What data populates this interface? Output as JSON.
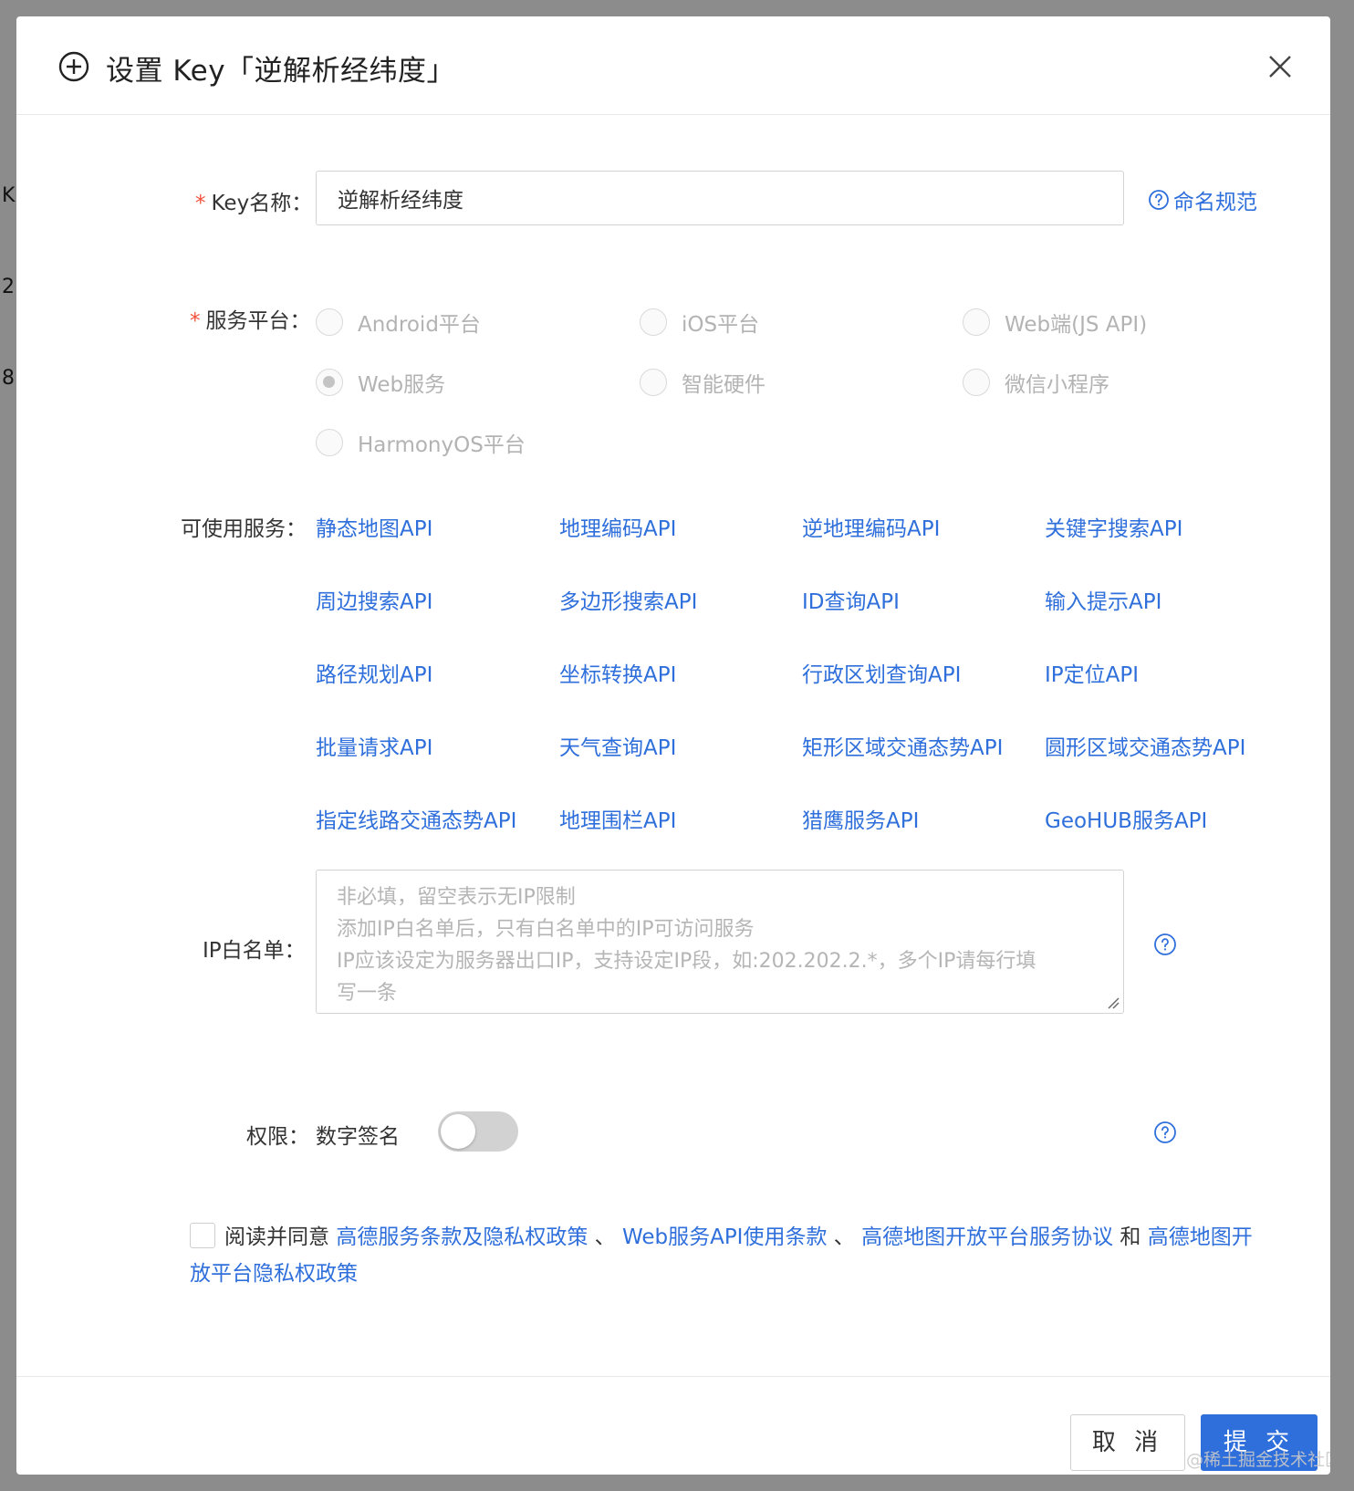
{
  "background": {
    "chars": [
      "K",
      "2",
      "8"
    ]
  },
  "dialog": {
    "title": "设置 Key「逆解析经纬度」",
    "title_icon": "plus-circle-icon",
    "close_icon": "close-icon"
  },
  "form": {
    "key_name": {
      "label": "Key名称：",
      "value": "逆解析经纬度",
      "help_link": "命名规范"
    },
    "platform": {
      "label": "服务平台：",
      "options": [
        "Android平台",
        "iOS平台",
        "Web端(JS API)",
        "Web服务",
        "智能硬件",
        "微信小程序",
        "HarmonyOS平台"
      ],
      "selected": "Web服务"
    },
    "services": {
      "label": "可使用服务：",
      "items": [
        "静态地图API",
        "地理编码API",
        "逆地理编码API",
        "关键字搜索API",
        "周边搜索API",
        "多边形搜索API",
        "ID查询API",
        "输入提示API",
        "路径规划API",
        "坐标转换API",
        "行政区划查询API",
        "IP定位API",
        "批量请求API",
        "天气查询API",
        "矩形区域交通态势API",
        "圆形区域交通态势API",
        "指定线路交通态势API",
        "地理围栏API",
        "猎鹰服务API",
        "GeoHUB服务API"
      ]
    },
    "ip_whitelist": {
      "label": "IP白名单：",
      "placeholder_lines": [
        "非必填，留空表示无IP限制",
        "添加IP白名单后，只有白名单中的IP可访问服务",
        "IP应该设定为服务器出口IP，支持设定IP段，如:202.202.2.*，多个IP请每行填",
        "写一条"
      ]
    },
    "permission": {
      "label": "权限：",
      "option": "数字签名",
      "enabled": false
    },
    "agreement": {
      "prefix": "阅读并同意",
      "link1": "高德服务条款及隐私权政策",
      "sep1": "、",
      "link2": "Web服务API使用条款",
      "sep2": "、",
      "link3": "高德地图开放平台服务协议",
      "and": "和",
      "link4": "高德地图开放平台隐私权政策",
      "checked": false
    }
  },
  "footer": {
    "cancel": "取 消",
    "submit": "提 交"
  },
  "watermark": "@稀土掘金技术社区",
  "colors": {
    "link": "#2f6fdb",
    "required": "#f5503c",
    "primary": "#2f6fdb"
  }
}
